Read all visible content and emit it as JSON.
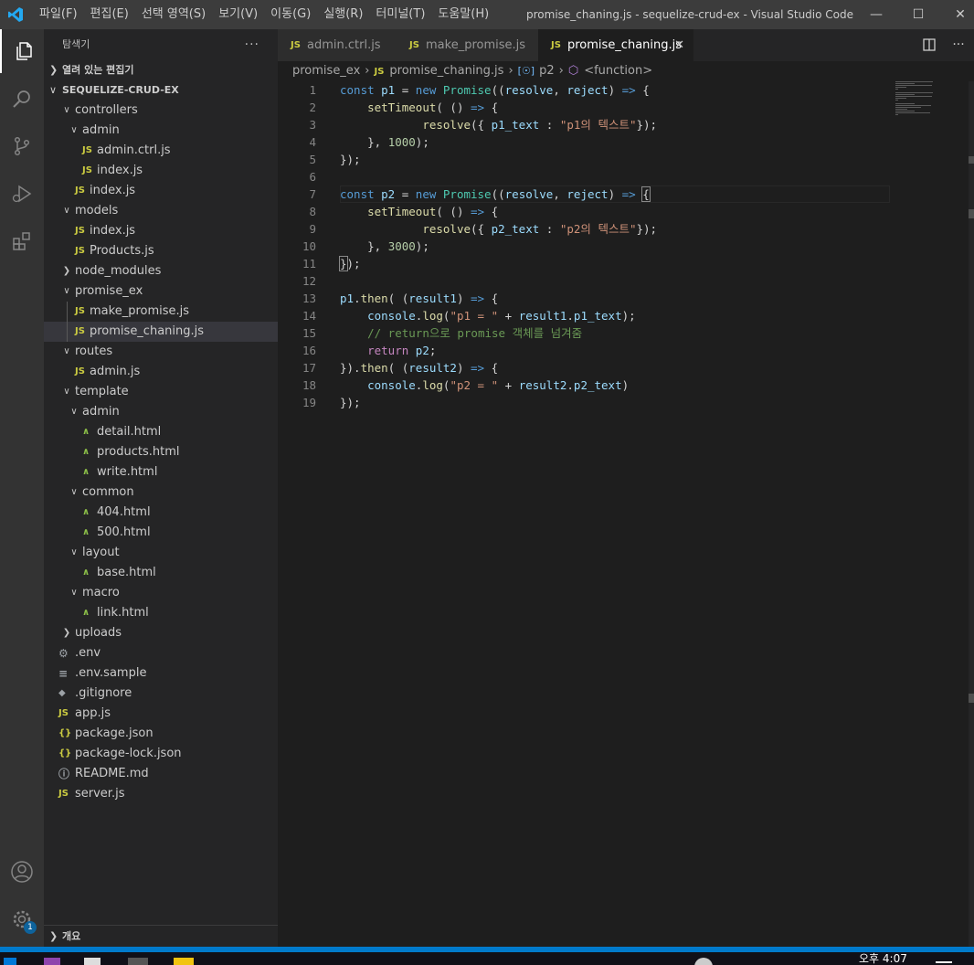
{
  "titlebar": {
    "menu": [
      "파일(F)",
      "편집(E)",
      "선택 영역(S)",
      "보기(V)",
      "이동(G)",
      "실행(R)",
      "터미널(T)",
      "도움말(H)"
    ],
    "title": "promise_chaning.js - sequelize-crud-ex - Visual Studio Code",
    "minimize": "—",
    "maximize": "☐",
    "close": "✕"
  },
  "activity_bar": {
    "items": [
      "explorer-icon",
      "search-icon",
      "source-control-icon",
      "run-debug-icon",
      "extensions-icon"
    ],
    "bottom": [
      "account-icon",
      "settings-gear-icon"
    ],
    "settings_badge": "1"
  },
  "sidebar": {
    "header": "탐색기",
    "more": "···",
    "open_editors": "열려 있는 편집기",
    "project": "SEQUELIZE-CRUD-EX",
    "outline": "개요",
    "tree": [
      {
        "label": "controllers",
        "type": "folder",
        "open": true,
        "depth": 0
      },
      {
        "label": "admin",
        "type": "folder",
        "open": true,
        "depth": 1
      },
      {
        "label": "admin.ctrl.js",
        "type": "js",
        "depth": 2
      },
      {
        "label": "index.js",
        "type": "js",
        "depth": 2
      },
      {
        "label": "index.js",
        "type": "js",
        "depth": 1
      },
      {
        "label": "models",
        "type": "folder",
        "open": true,
        "depth": 0
      },
      {
        "label": "index.js",
        "type": "js",
        "depth": 1
      },
      {
        "label": "Products.js",
        "type": "js",
        "depth": 1
      },
      {
        "label": "node_modules",
        "type": "folder",
        "open": false,
        "depth": 0
      },
      {
        "label": "promise_ex",
        "type": "folder",
        "open": true,
        "depth": 0
      },
      {
        "label": "make_promise.js",
        "type": "js",
        "depth": 1
      },
      {
        "label": "promise_chaning.js",
        "type": "js",
        "depth": 1,
        "selected": true
      },
      {
        "label": "routes",
        "type": "folder",
        "open": true,
        "depth": 0
      },
      {
        "label": "admin.js",
        "type": "js",
        "depth": 1
      },
      {
        "label": "template",
        "type": "folder",
        "open": true,
        "depth": 0
      },
      {
        "label": "admin",
        "type": "folder",
        "open": true,
        "depth": 1
      },
      {
        "label": "detail.html",
        "type": "html",
        "depth": 2
      },
      {
        "label": "products.html",
        "type": "html",
        "depth": 2
      },
      {
        "label": "write.html",
        "type": "html",
        "depth": 2
      },
      {
        "label": "common",
        "type": "folder",
        "open": true,
        "depth": 1
      },
      {
        "label": "404.html",
        "type": "html",
        "depth": 2
      },
      {
        "label": "500.html",
        "type": "html",
        "depth": 2
      },
      {
        "label": "layout",
        "type": "folder",
        "open": true,
        "depth": 1
      },
      {
        "label": "base.html",
        "type": "html",
        "depth": 2
      },
      {
        "label": "macro",
        "type": "folder",
        "open": true,
        "depth": 1
      },
      {
        "label": "link.html",
        "type": "html",
        "depth": 2
      },
      {
        "label": "uploads",
        "type": "folder",
        "open": false,
        "depth": 0
      },
      {
        "label": ".env",
        "type": "gear",
        "depth": 0
      },
      {
        "label": ".env.sample",
        "type": "lines",
        "depth": 0
      },
      {
        "label": ".gitignore",
        "type": "diamond",
        "depth": 0
      },
      {
        "label": "app.js",
        "type": "js",
        "depth": 0
      },
      {
        "label": "package.json",
        "type": "json",
        "depth": 0
      },
      {
        "label": "package-lock.json",
        "type": "json",
        "depth": 0
      },
      {
        "label": "README.md",
        "type": "info",
        "depth": 0
      },
      {
        "label": "server.js",
        "type": "js",
        "depth": 0
      }
    ]
  },
  "tabs": [
    {
      "label": "admin.ctrl.js",
      "badge": "JS",
      "active": false
    },
    {
      "label": "make_promise.js",
      "badge": "JS",
      "active": false
    },
    {
      "label": "promise_chaning.js",
      "badge": "JS",
      "active": true
    }
  ],
  "tab_close": "✕",
  "breadcrumb": [
    "promise_ex",
    "promise_chaning.js",
    "p2",
    "<function>"
  ],
  "editor": {
    "current_line": 7,
    "lines": [
      [
        [
          "const ",
          "k"
        ],
        [
          "p1",
          "v"
        ],
        [
          " = ",
          ""
        ],
        [
          "new ",
          "k"
        ],
        [
          "Promise",
          "c"
        ],
        [
          "((",
          ""
        ],
        [
          "resolve",
          "v"
        ],
        [
          ", ",
          ""
        ],
        [
          "reject",
          "v"
        ],
        [
          ") ",
          ""
        ],
        [
          "=>",
          "k"
        ],
        [
          " {",
          ""
        ]
      ],
      [
        [
          "    ",
          ""
        ],
        [
          "setTimeout",
          "f"
        ],
        [
          "( () ",
          ""
        ],
        [
          "=>",
          "k"
        ],
        [
          " {",
          ""
        ]
      ],
      [
        [
          "            ",
          ""
        ],
        [
          "resolve",
          "f"
        ],
        [
          "({ ",
          ""
        ],
        [
          "p1_text",
          "v"
        ],
        [
          " : ",
          ""
        ],
        [
          "\"p1의 텍스트\"",
          "s"
        ],
        [
          "});",
          ""
        ]
      ],
      [
        [
          "    }, ",
          ""
        ],
        [
          "1000",
          "n"
        ],
        [
          ");",
          ""
        ]
      ],
      [
        [
          "});",
          ""
        ]
      ],
      [
        [
          "",
          ""
        ]
      ],
      [
        [
          "const ",
          "k"
        ],
        [
          "p2",
          "v"
        ],
        [
          " = ",
          ""
        ],
        [
          "new ",
          "k"
        ],
        [
          "Promise",
          "c"
        ],
        [
          "((",
          ""
        ],
        [
          "resolve",
          "v"
        ],
        [
          ", ",
          ""
        ],
        [
          "reject",
          "v"
        ],
        [
          ") ",
          ""
        ],
        [
          "=>",
          "k"
        ],
        [
          " ",
          ""
        ],
        [
          "{",
          "bm"
        ]
      ],
      [
        [
          "    ",
          ""
        ],
        [
          "setTimeout",
          "f"
        ],
        [
          "( () ",
          ""
        ],
        [
          "=>",
          "k"
        ],
        [
          " {",
          ""
        ]
      ],
      [
        [
          "            ",
          ""
        ],
        [
          "resolve",
          "f"
        ],
        [
          "({ ",
          ""
        ],
        [
          "p2_text",
          "v"
        ],
        [
          " : ",
          ""
        ],
        [
          "\"p2의 텍스트\"",
          "s"
        ],
        [
          "});",
          ""
        ]
      ],
      [
        [
          "    }, ",
          ""
        ],
        [
          "3000",
          "n"
        ],
        [
          ");",
          ""
        ]
      ],
      [
        [
          "}",
          "bm"
        ],
        [
          ");",
          ""
        ]
      ],
      [
        [
          "",
          ""
        ]
      ],
      [
        [
          "p1",
          "v"
        ],
        [
          ".",
          ""
        ],
        [
          "then",
          "f"
        ],
        [
          "( (",
          ""
        ],
        [
          "result1",
          "v"
        ],
        [
          ") ",
          ""
        ],
        [
          "=>",
          "k"
        ],
        [
          " {",
          ""
        ]
      ],
      [
        [
          "    ",
          ""
        ],
        [
          "console",
          "v"
        ],
        [
          ".",
          ""
        ],
        [
          "log",
          "f"
        ],
        [
          "(",
          ""
        ],
        [
          "\"p1 = \"",
          "s"
        ],
        [
          " + ",
          ""
        ],
        [
          "result1",
          "v"
        ],
        [
          ".",
          ""
        ],
        [
          "p1_text",
          "v"
        ],
        [
          ");",
          ""
        ]
      ],
      [
        [
          "    ",
          ""
        ],
        [
          "// return으로 promise 객체를 넘겨줌",
          "cm"
        ]
      ],
      [
        [
          "    ",
          ""
        ],
        [
          "return ",
          "ctl"
        ],
        [
          "p2",
          "v"
        ],
        [
          ";",
          ""
        ]
      ],
      [
        [
          "}).",
          ""
        ],
        [
          "then",
          "f"
        ],
        [
          "( (",
          ""
        ],
        [
          "result2",
          "v"
        ],
        [
          ") ",
          ""
        ],
        [
          "=>",
          "k"
        ],
        [
          " {",
          ""
        ]
      ],
      [
        [
          "    ",
          ""
        ],
        [
          "console",
          "v"
        ],
        [
          ".",
          ""
        ],
        [
          "log",
          "f"
        ],
        [
          "(",
          ""
        ],
        [
          "\"p2 = \"",
          "s"
        ],
        [
          " + ",
          ""
        ],
        [
          "result2",
          "v"
        ],
        [
          ".",
          ""
        ],
        [
          "p2_text",
          "v"
        ],
        [
          ")",
          ""
        ]
      ],
      [
        [
          "});",
          ""
        ]
      ]
    ]
  },
  "taskbar": {
    "clock": "오후 4:07"
  },
  "colors": {
    "accent": "#007acc",
    "js_badge": "#cbcb41",
    "html_icon": "#8dc149"
  }
}
